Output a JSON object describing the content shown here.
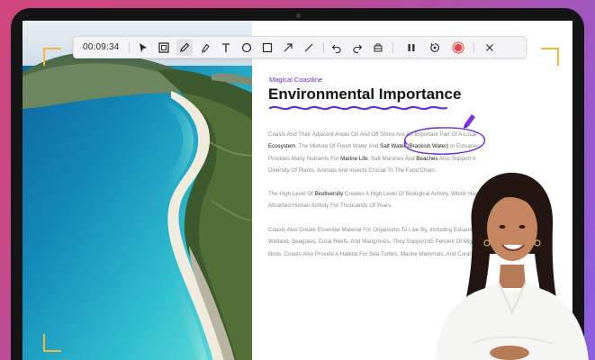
{
  "toolbar": {
    "timer": "00:09:34",
    "tools": [
      {
        "name": "select-arrow-icon"
      },
      {
        "name": "screen-capture-icon"
      },
      {
        "name": "pen-icon",
        "active": true
      },
      {
        "name": "highlighter-icon"
      },
      {
        "name": "text-icon"
      },
      {
        "name": "circle-icon"
      },
      {
        "name": "square-icon"
      },
      {
        "name": "arrow-icon"
      },
      {
        "name": "line-icon"
      },
      {
        "name": "undo-icon"
      },
      {
        "name": "redo-icon"
      },
      {
        "name": "eraser-icon"
      },
      {
        "name": "pause-icon"
      },
      {
        "name": "restart-icon"
      },
      {
        "name": "stop-record-icon"
      },
      {
        "name": "close-icon"
      }
    ]
  },
  "document": {
    "subtitle": "Magical Coastline",
    "title": "Environmental Importance",
    "paragraph1": {
      "t1": "Coasts And Their Adjacent Areas On And Off Shore Are An Important Part Of A Local ",
      "k1": "Ecosystem",
      "t2": ". The Mixture Of Fresh Water And ",
      "k2": "Salt Water (Brackish Water)",
      "t3": " In Estuaries Provides Many Nutrients For ",
      "k3": "Marine Life",
      "t4": ". Salt Marshes And ",
      "k4": "Beaches",
      "t5": " Also Support A Diversity Of Plants, Animals And Insects Crucial To The Food Chain."
    },
    "paragraph2": {
      "t1": "The High Level Of ",
      "k1": "Biodiversity",
      "t2": " Creates A High Level Of Biological Activity, Which Has Attracted Human Activity For Thousands Of Years."
    },
    "paragraph3": "Coasts Also Create Essential Material For Organisms To Live By, Including Estuaries, Wetland, Seagrass, Coral Reefs, And Mangroves. They Support 85 Percent Of Migratory Birds. Coasts Also Provide A Habitat For Sea Turtles, Marine Mammals, And Coral Reefs."
  },
  "colors": {
    "accent": "#6a2bd9",
    "record": "#ee4444",
    "corner": "#f5b83d"
  }
}
